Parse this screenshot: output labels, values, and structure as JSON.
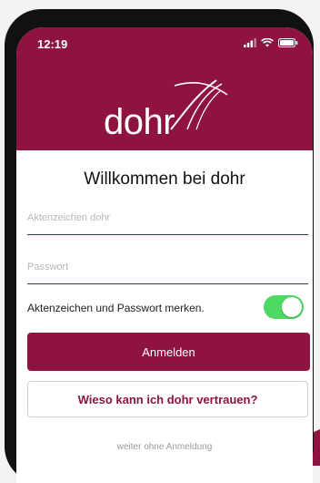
{
  "status_bar": {
    "time": "12:19",
    "icons": [
      "signal-icon",
      "wifi-icon",
      "battery-icon"
    ]
  },
  "brand": {
    "logo_text": "dohr",
    "color": "#8e1340"
  },
  "welcome_title": "Willkommen bei dohr",
  "form": {
    "case_number": {
      "value": "",
      "placeholder": "Aktenzeichen dohr"
    },
    "password": {
      "value": "",
      "placeholder": "Passwort"
    },
    "remember_label": "Aktenzeichen und Passwort merken.",
    "remember_on": true,
    "toggle_color": "#4cd964"
  },
  "buttons": {
    "login_label": "Anmelden",
    "trust_label": "Wieso kann ich dohr vertrauen?"
  },
  "skip_label": "weiter ohne Anmeldung"
}
